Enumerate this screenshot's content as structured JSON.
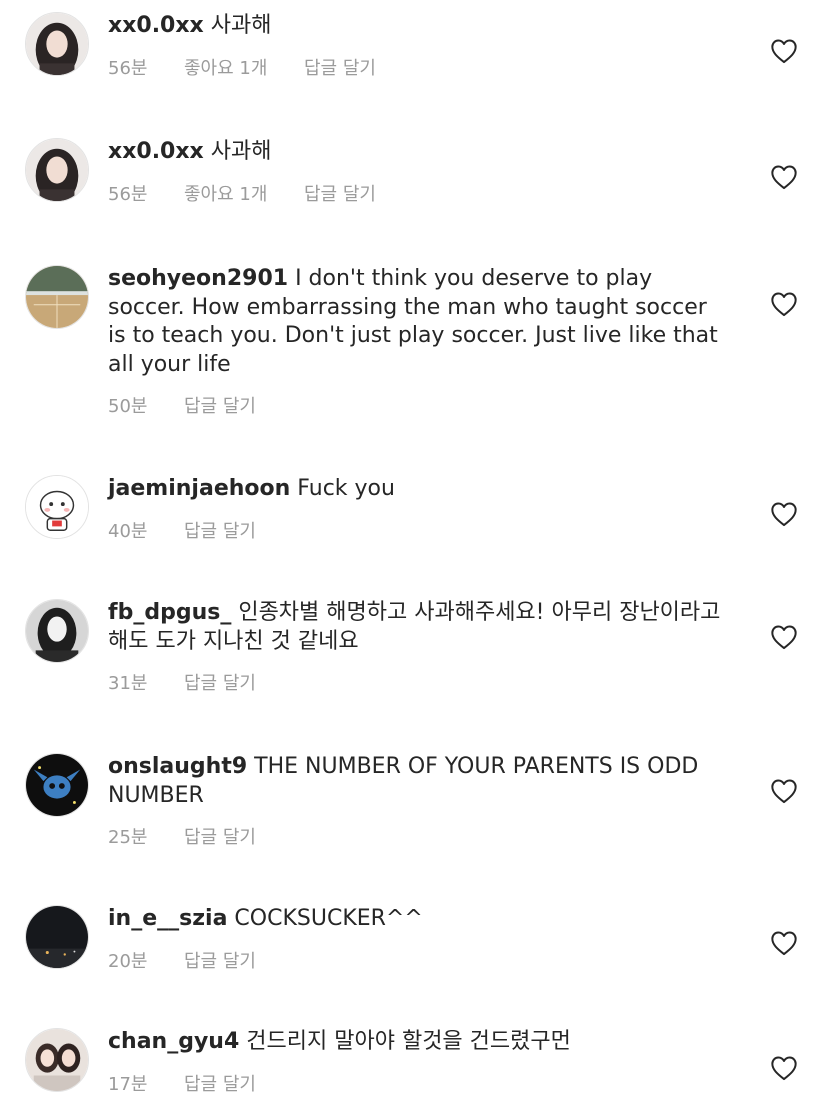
{
  "comments": [
    {
      "username": "xx0.0xx",
      "text": "사과해",
      "time": "56분",
      "likes": "좋아요 1개",
      "reply": "답글 달기"
    },
    {
      "username": "xx0.0xx",
      "text": "사과해",
      "time": "56분",
      "likes": "좋아요 1개",
      "reply": "답글 달기"
    },
    {
      "username": "seohyeon2901",
      "text": "I don't think you deserve to play soccer. How embarrassing the man who taught soccer is to teach you. Don't just play soccer. Just live like that all your life",
      "time": "50분",
      "reply": "답글 달기"
    },
    {
      "username": "jaeminjaehoon",
      "text": "Fuck you",
      "time": "40분",
      "reply": "답글 달기"
    },
    {
      "username": "fb_dpgus_",
      "text": "인종차별 해명하고 사과해주세요! 아무리 장난이라고 해도 도가 지나친 것 같네요",
      "time": "31분",
      "reply": "답글 달기"
    },
    {
      "username": "onslaught9",
      "text": "THE NUMBER OF YOUR PARENTS IS ODD NUMBER",
      "time": "25분",
      "reply": "답글 달기"
    },
    {
      "username": "in_e__szia",
      "text": "COCKSUCKER^^",
      "time": "20분",
      "reply": "답글 달기"
    },
    {
      "username": "chan_gyu4",
      "text": "건드리지 말아야 할것을 건드렸구먼",
      "time": "17분",
      "reply": "답글 달기"
    }
  ],
  "icons": {
    "like": "heart-outline-icon"
  },
  "colors": {
    "text": "#262626",
    "meta": "#9b9b9b",
    "background": "#ffffff"
  }
}
